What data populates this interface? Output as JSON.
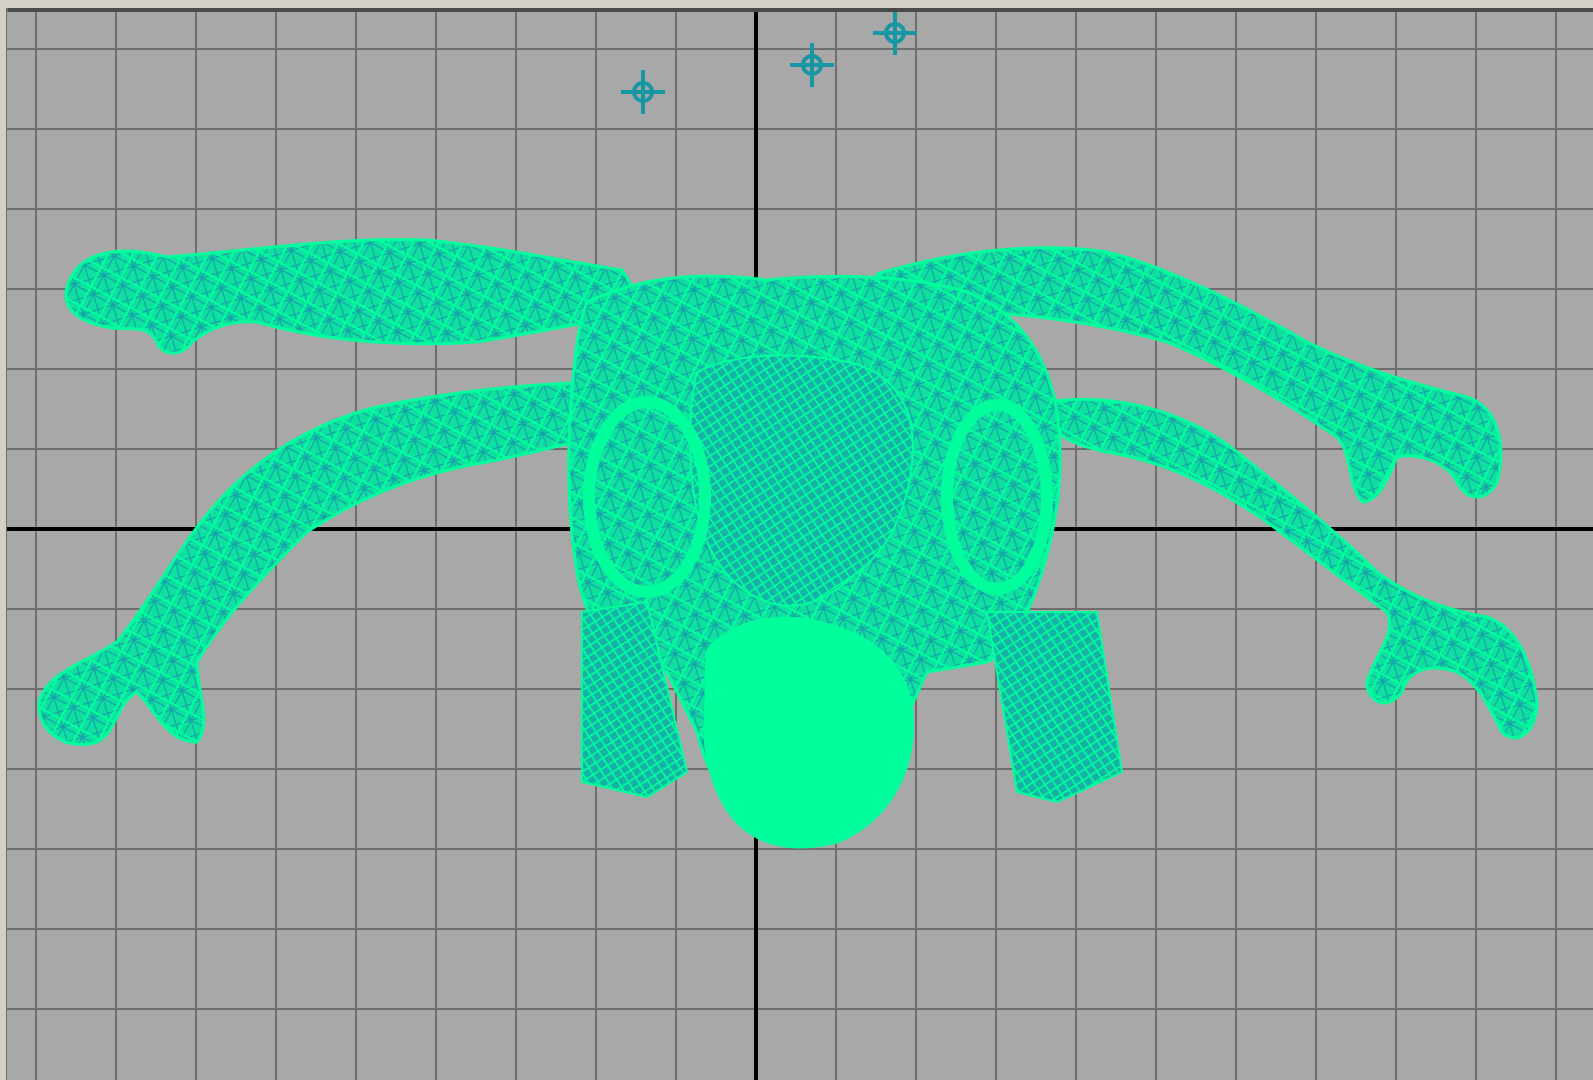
{
  "viewport": {
    "name": "orthographic-front-view",
    "background_color": "#a8a8a8",
    "grid_color": "#6e6e6e",
    "axis_color": "#000000",
    "wire_color": "#00ff9c",
    "wire_shadow_color": "#159aa6",
    "frame_color": "#d4d0c8"
  }
}
